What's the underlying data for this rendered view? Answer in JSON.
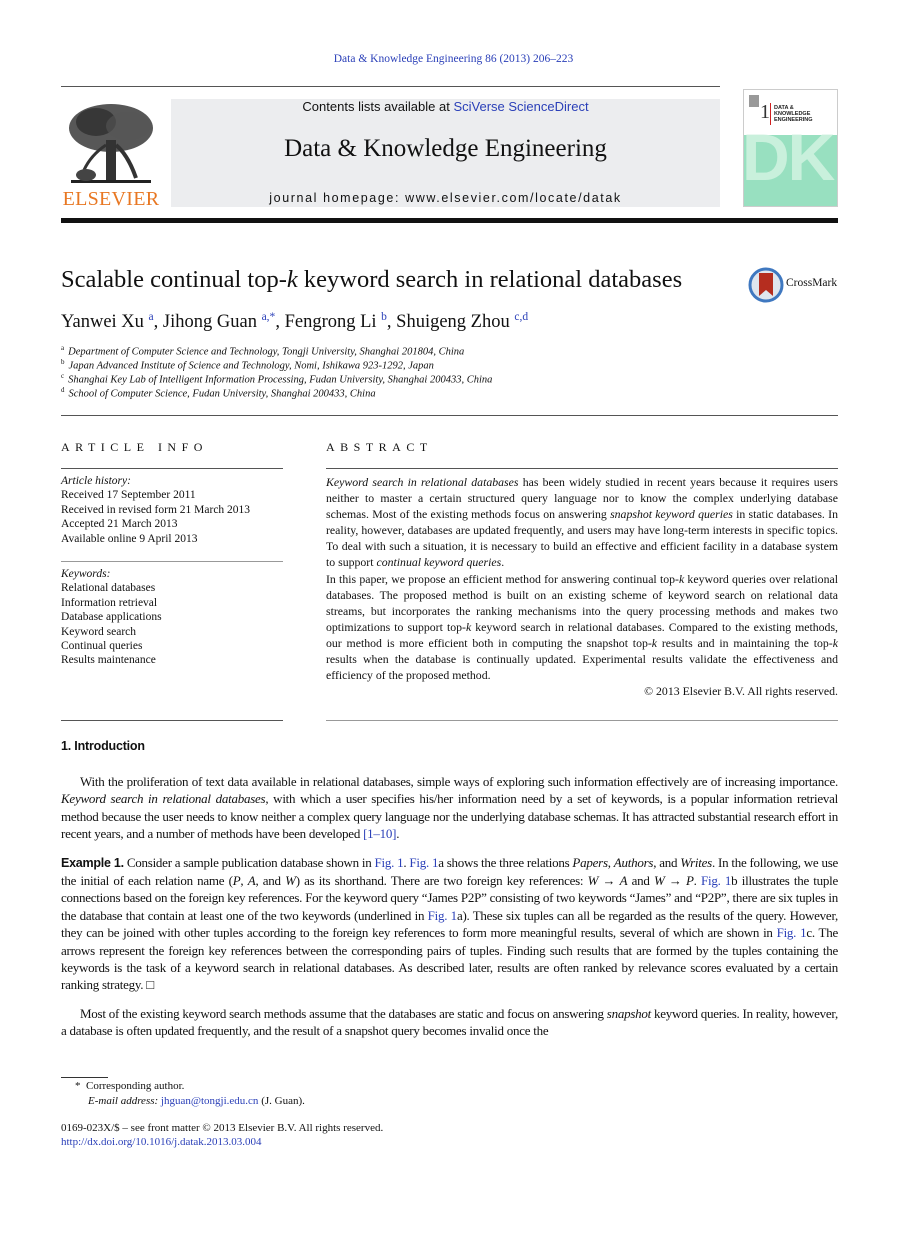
{
  "header": {
    "journal_ref": "Data & Knowledge Engineering 86 (2013) 206–223",
    "contents_prefix": "Contents lists available at ",
    "contents_link": "SciVerse ScienceDirect",
    "journal_title": "Data & Knowledge Engineering",
    "homepage": "journal homepage: www.elsevier.com/locate/datak",
    "publisher_logo_text": "ELSEVIER",
    "cover": {
      "number": "1",
      "title_lines": [
        "DATA &",
        "KNOWLEDGE",
        "ENGINEERING"
      ],
      "big_letters": "DKE"
    },
    "colors": {
      "link": "#2a3fb8",
      "elsevier_orange": "#e87722",
      "banner_bg": "#ecedef",
      "cover_green": "#98e0c0"
    }
  },
  "article": {
    "title_pre": "Scalable continual top-",
    "title_k": "k",
    "title_post": " keyword search in relational databases",
    "crossmark_label": "CrossMark",
    "authors": [
      {
        "name": "Yanwei Xu",
        "sup": "a"
      },
      {
        "name": "Jihong Guan",
        "sup": "a,*"
      },
      {
        "name": "Fengrong Li",
        "sup": "b"
      },
      {
        "name": "Shuigeng Zhou",
        "sup": "c,d"
      }
    ],
    "affiliations": [
      {
        "key": "a",
        "text": "Department of Computer Science and Technology, Tongji University, Shanghai 201804, China"
      },
      {
        "key": "b",
        "text": "Japan Advanced Institute of Science and Technology, Nomi, Ishikawa 923-1292, Japan"
      },
      {
        "key": "c",
        "text": "Shanghai Key Lab of Intelligent Information Processing, Fudan University, Shanghai 200433, China"
      },
      {
        "key": "d",
        "text": "School of Computer Science, Fudan University, Shanghai 200433, China"
      }
    ]
  },
  "article_info": {
    "heading": "ARTICLE INFO",
    "history_label": "Article history:",
    "history": [
      "Received 17 September 2011",
      "Received in revised form 21 March 2013",
      "Accepted 21 March 2013",
      "Available online 9 April 2013"
    ],
    "keywords_label": "Keywords:",
    "keywords": [
      "Relational databases",
      "Information retrieval",
      "Database applications",
      "Keyword search",
      "Continual queries",
      "Results maintenance"
    ]
  },
  "abstract": {
    "heading": "ABSTRACT",
    "p1": [
      {
        "t": "Keyword search in relational databases",
        "i": true
      },
      {
        "t": " has been widely studied in recent years because it requires users neither to master a certain structured query language nor to know the complex underlying database schemas. Most of the existing methods focus on answering "
      },
      {
        "t": "snapshot keyword queries",
        "i": true
      },
      {
        "t": " in static databases. In reality, however, databases are updated frequently, and users may have long-term interests in specific topics. To deal with such a situation, it is necessary to build an effective and efficient facility in a database system to support "
      },
      {
        "t": "continual keyword queries",
        "i": true
      },
      {
        "t": "."
      }
    ],
    "p2": [
      {
        "t": "In this paper, we propose an efficient method for answering continual top-"
      },
      {
        "t": "k",
        "i": true
      },
      {
        "t": " keyword queries over relational databases. The proposed method is built on an existing scheme of keyword search on relational data streams, but incorporates the ranking mechanisms into the query processing methods and makes two optimizations to support top-"
      },
      {
        "t": "k",
        "i": true
      },
      {
        "t": " keyword search in relational databases. Compared to the existing methods, our method is more efficient both in computing the snapshot top-"
      },
      {
        "t": "k",
        "i": true
      },
      {
        "t": " results and in maintaining the top-"
      },
      {
        "t": "k",
        "i": true
      },
      {
        "t": " results when the database is continually updated. Experimental results validate the effectiveness and efficiency of the proposed method."
      }
    ],
    "copyright": "© 2013 Elsevier B.V. All rights reserved."
  },
  "intro": {
    "heading": "1. Introduction",
    "p1": [
      {
        "t": "With the proliferation of text data available in relational databases, simple ways of exploring such information effectively are of increasing importance. "
      },
      {
        "t": "Keyword search in relational databases",
        "i": true
      },
      {
        "t": ", with which a user specifies his/her information need by a set of keywords, is a popular information retrieval method because the user needs to know neither a complex query language nor the underlying database schemas. It has attracted substantial research effort in recent years, and a number of methods have been developed "
      },
      {
        "t": "[1–10]",
        "link": true
      },
      {
        "t": "."
      }
    ],
    "example": [
      {
        "t": "Example 1.",
        "b": true
      },
      {
        "t": "  Consider a sample publication database shown in "
      },
      {
        "t": "Fig. 1",
        "link": true
      },
      {
        "t": ". "
      },
      {
        "t": "Fig. 1",
        "link": true
      },
      {
        "t": "a shows the three relations "
      },
      {
        "t": "Papers",
        "i": true
      },
      {
        "t": ", "
      },
      {
        "t": "Authors",
        "i": true
      },
      {
        "t": ", and "
      },
      {
        "t": "Writes",
        "i": true
      },
      {
        "t": ". In the following, we use the initial of each relation name ("
      },
      {
        "t": "P",
        "i": true
      },
      {
        "t": ", "
      },
      {
        "t": "A",
        "i": true
      },
      {
        "t": ", and "
      },
      {
        "t": "W",
        "i": true
      },
      {
        "t": ") as its shorthand. There are two foreign key references: "
      },
      {
        "t": "W",
        "i": true
      },
      {
        "t": " → "
      },
      {
        "t": "A",
        "i": true
      },
      {
        "t": " and "
      },
      {
        "t": "W",
        "i": true
      },
      {
        "t": " → "
      },
      {
        "t": "P",
        "i": true
      },
      {
        "t": ". "
      },
      {
        "t": "Fig. 1",
        "link": true
      },
      {
        "t": "b illustrates the tuple connections based on the foreign key references. For the keyword query “James P2P” consisting of two keywords “James” and “P2P”, there are six tuples in the database that contain at least one of the two keywords (underlined in "
      },
      {
        "t": "Fig. 1",
        "link": true
      },
      {
        "t": "a). These six tuples can all be regarded as the results of the query. However, they can be joined with other tuples according to the foreign key references to form more meaningful results, several of which are shown in "
      },
      {
        "t": "Fig. 1",
        "link": true
      },
      {
        "t": "c. The arrows represent the foreign key references between the corresponding pairs of tuples. Finding such results that are formed by the tuples containing the keywords is the task of a keyword search in relational databases. As described later, results are often ranked by relevance scores evaluated by a certain ranking strategy. □"
      }
    ],
    "p2": [
      {
        "t": "Most of the existing keyword search methods assume that the databases are static and focus on answering "
      },
      {
        "t": "snapshot",
        "i": true
      },
      {
        "t": " keyword queries. In reality, however, a database is often updated frequently, and the result of a snapshot query becomes invalid once the"
      }
    ]
  },
  "footnote": {
    "marker": "*",
    "corresponding": "Corresponding author.",
    "email_label": "E-mail address:",
    "email": "jhguan@tongji.edu.cn",
    "email_suffix": " (J. Guan)."
  },
  "footer": {
    "issn_line": "0169-023X/$ – see front matter © 2013 Elsevier B.V. All rights reserved.",
    "doi": "http://dx.doi.org/10.1016/j.datak.2013.03.004"
  }
}
